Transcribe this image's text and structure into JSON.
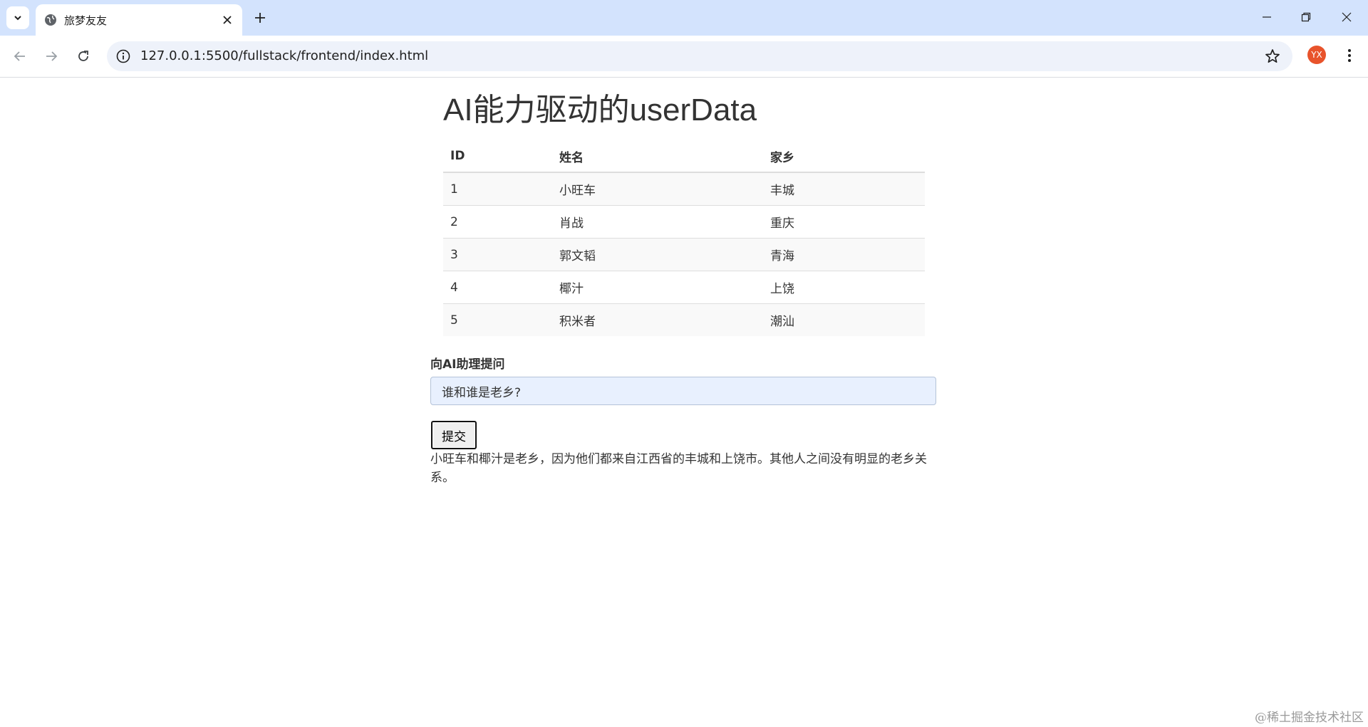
{
  "browser": {
    "tab_title": "旅梦友友",
    "url": "127.0.0.1:5500/fullstack/frontend/index.html",
    "profile_initials": "YX",
    "profile_color": "#e8532b"
  },
  "page": {
    "heading": "AI能力驱动的userData",
    "table": {
      "headers": [
        "ID",
        "姓名",
        "家乡"
      ],
      "rows": [
        [
          "1",
          "小旺车",
          "丰城"
        ],
        [
          "2",
          "肖战",
          "重庆"
        ],
        [
          "3",
          "郭文韬",
          "青海"
        ],
        [
          "4",
          "椰汁",
          "上饶"
        ],
        [
          "5",
          "积米者",
          "潮汕"
        ]
      ]
    },
    "question_label": "向AI助理提问",
    "question_value": "谁和谁是老乡?",
    "submit_label": "提交",
    "answer": "小旺车和椰汁是老乡，因为他们都来自江西省的丰城和上饶市。其他人之间没有明显的老乡关系。"
  },
  "watermark": "@稀土掘金技术社区"
}
